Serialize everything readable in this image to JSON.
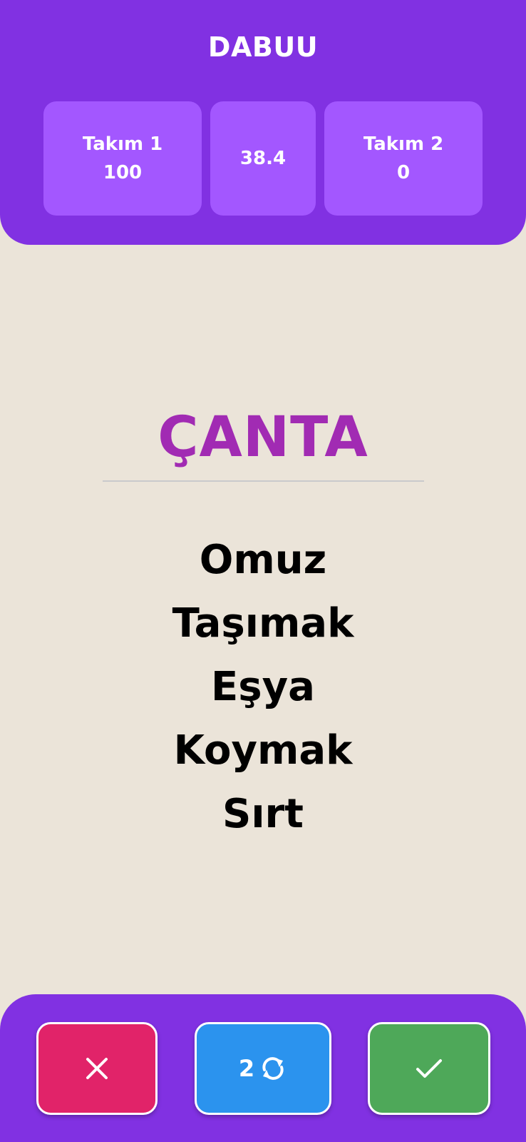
{
  "header": {
    "title": "DABUU",
    "team1": {
      "name": "Takım 1",
      "score": "100"
    },
    "timer": "38.4",
    "team2": {
      "name": "Takım 2",
      "score": "0"
    }
  },
  "card": {
    "word": "ÇANTA",
    "taboo_words": [
      "Omuz",
      "Taşımak",
      "Eşya",
      "Koymak",
      "Sırt"
    ]
  },
  "controls": {
    "wrong_icon": "close-icon",
    "pass_count": "2",
    "pass_icon": "refresh-icon",
    "correct_icon": "check-icon"
  },
  "colors": {
    "header_bg": "#8131e2",
    "score_card_bg": "#a357ff",
    "background": "#ebe4d9",
    "word_color": "#a12bb3",
    "wrong_button": "#e12369",
    "pass_button": "#2b93ee",
    "correct_button": "#4ea859"
  }
}
